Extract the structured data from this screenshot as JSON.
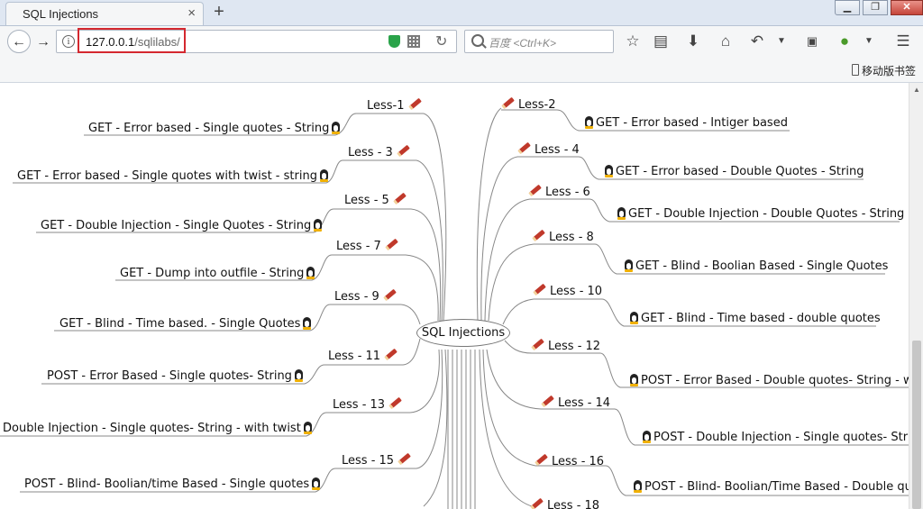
{
  "browser": {
    "tab_title": "SQL Injections",
    "tab_close": "×",
    "new_tab": "+",
    "url_host": "127.0.0.1",
    "url_path": "/sqlilabs/",
    "search_placeholder": "百度 <Ctrl+K>",
    "mobile_bookmarks": "移动版书签"
  },
  "mindmap": {
    "center": "SQL Injections",
    "left": [
      {
        "less": "Less-1",
        "topic": "GET - Error based - Single quotes - String"
      },
      {
        "less": "Less - 3",
        "topic": "GET - Error based - Single quotes with twist - string"
      },
      {
        "less": "Less - 5",
        "topic": "GET - Double Injection - Single Quotes - String"
      },
      {
        "less": "Less - 7",
        "topic": "GET - Dump into outfile - String"
      },
      {
        "less": "Less - 9",
        "topic": "GET - Blind - Time based. -  Single Quotes"
      },
      {
        "less": "Less - 11",
        "topic": "POST - Error Based - Single quotes- String"
      },
      {
        "less": "Less - 13",
        "topic": "Double Injection - Single quotes- String - with twist"
      },
      {
        "less": "Less - 15",
        "topic": "POST - Blind- Boolian/time Based - Single quotes"
      }
    ],
    "right": [
      {
        "less": "Less-2",
        "topic": "GET - Error based - Intiger based"
      },
      {
        "less": "Less - 4",
        "topic": "GET - Error based - Double Quotes - String"
      },
      {
        "less": "Less - 6",
        "topic": "GET - Double Injection - Double Quotes - String"
      },
      {
        "less": "Less - 8",
        "topic": "GET - Blind - Boolian Based - Single Quotes"
      },
      {
        "less": "Less - 10",
        "topic": "GET - Blind - Time based - double quotes"
      },
      {
        "less": "Less - 12",
        "topic": "POST - Error Based - Double quotes- String - wi"
      },
      {
        "less": "Less - 14",
        "topic": "POST - Double Injection - Single quotes- Strin"
      },
      {
        "less": "Less - 16",
        "topic": "POST - Blind- Boolian/Time Based - Double quo"
      },
      {
        "less": "Less - 18",
        "topic": ""
      }
    ]
  }
}
